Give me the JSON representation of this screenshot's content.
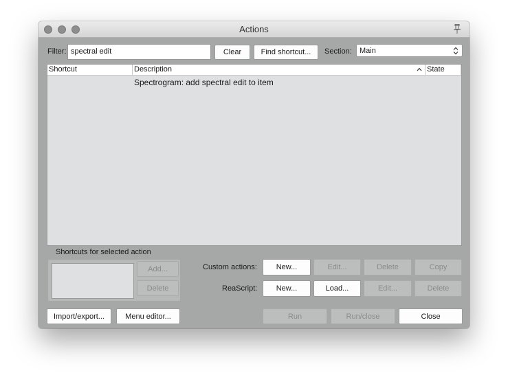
{
  "window": {
    "title": "Actions"
  },
  "filter": {
    "label": "Filter:",
    "value": "spectral edit"
  },
  "buttons": {
    "clear": "Clear",
    "find_shortcut": "Find shortcut...",
    "add": "Add...",
    "delete_shortcut": "Delete",
    "custom_new": "New...",
    "custom_edit": "Edit...",
    "custom_delete": "Delete",
    "custom_copy": "Copy",
    "reascript_new": "New...",
    "reascript_load": "Load...",
    "reascript_edit": "Edit...",
    "reascript_delete": "Delete",
    "import_export": "Import/export...",
    "menu_editor": "Menu editor...",
    "run": "Run",
    "run_close": "Run/close",
    "close": "Close"
  },
  "section": {
    "label": "Section:",
    "selected": "Main"
  },
  "table": {
    "columns": [
      "Shortcut",
      "Description",
      "State"
    ],
    "rows": [
      {
        "shortcut": "",
        "description": "Spectrogram: add spectral edit to item",
        "state": ""
      }
    ]
  },
  "shortcuts_panel": {
    "title": "Shortcuts for selected action"
  },
  "custom_actions": {
    "label": "Custom actions:"
  },
  "reascript": {
    "label": "ReaScript:"
  },
  "icons": {
    "pin": "pin-icon",
    "sort": "chevron-up-icon",
    "select_arrows": "up-down-arrows-icon"
  }
}
